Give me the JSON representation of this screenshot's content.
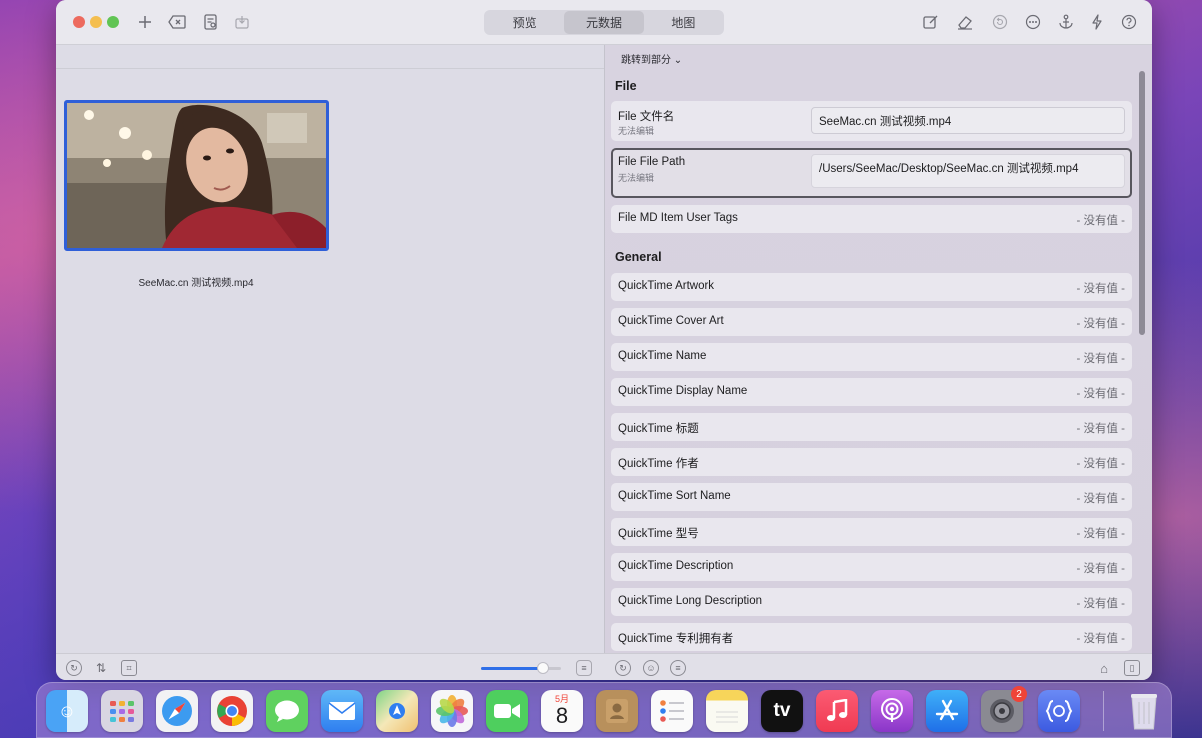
{
  "toolbar": {
    "tabs": [
      {
        "label": "预览",
        "active": false
      },
      {
        "label": "元数据",
        "active": true
      },
      {
        "label": "地图",
        "active": false
      }
    ],
    "icons_left": [
      "plus-icon",
      "delete-icon",
      "inspect-icon",
      "import-icon"
    ],
    "icons_right": [
      "edit-icon",
      "eraser-icon",
      "revert-icon",
      "more-icon",
      "anchor-icon",
      "bolt-icon",
      "help-icon"
    ]
  },
  "left_pane": {
    "thumbnail_filename": "SeeMac.cn 测试视频.mp4"
  },
  "right_pane": {
    "jump_label": "跳转到部分 ⌄",
    "sections": [
      {
        "title": "File",
        "rows": [
          {
            "label": "File 文件名",
            "sub": "无法编辑",
            "field": "SeeMac.cn 测试视频.mp4"
          },
          {
            "label": "File File Path",
            "sub": "无法编辑",
            "field": "/Users/SeeMac/Desktop/SeeMac.cn 测试视频.mp4"
          },
          {
            "label": "File MD Item User Tags",
            "value": "- 没有值 -"
          }
        ]
      },
      {
        "title": "General",
        "rows": [
          {
            "label": "QuickTime Artwork",
            "value": "- 没有值 -"
          },
          {
            "label": "QuickTime Cover Art",
            "value": "- 没有值 -"
          },
          {
            "label": "QuickTime Name",
            "value": "- 没有值 -"
          },
          {
            "label": "QuickTime Display Name",
            "value": "- 没有值 -"
          },
          {
            "label": "QuickTime 标题",
            "value": "- 没有值 -"
          },
          {
            "label": "QuickTime 作者",
            "value": "- 没有值 -"
          },
          {
            "label": "QuickTime Sort Name",
            "value": "- 没有值 -"
          },
          {
            "label": "QuickTime 型号",
            "value": "- 没有值 -"
          },
          {
            "label": "QuickTime Description",
            "value": "- 没有值 -"
          },
          {
            "label": "QuickTime Long Description",
            "value": "- 没有值 -"
          },
          {
            "label": "QuickTime 专利拥有者",
            "value": "- 没有值 -"
          }
        ]
      }
    ]
  },
  "bottom_bar": {
    "zoom_level": 0.78
  },
  "dock": {
    "apps": [
      "finder",
      "launchpad",
      "safari",
      "chrome",
      "messages",
      "mail",
      "maps",
      "photos",
      "facetime",
      "calendar",
      "contacts",
      "reminders",
      "notes",
      "apple-tv",
      "music",
      "podcasts",
      "app-store",
      "system-preferences",
      "metadata-app",
      "trash"
    ],
    "calendar_month": "5月",
    "calendar_day": "8",
    "appletv_label": "tv",
    "system_preferences_badge": "2"
  }
}
